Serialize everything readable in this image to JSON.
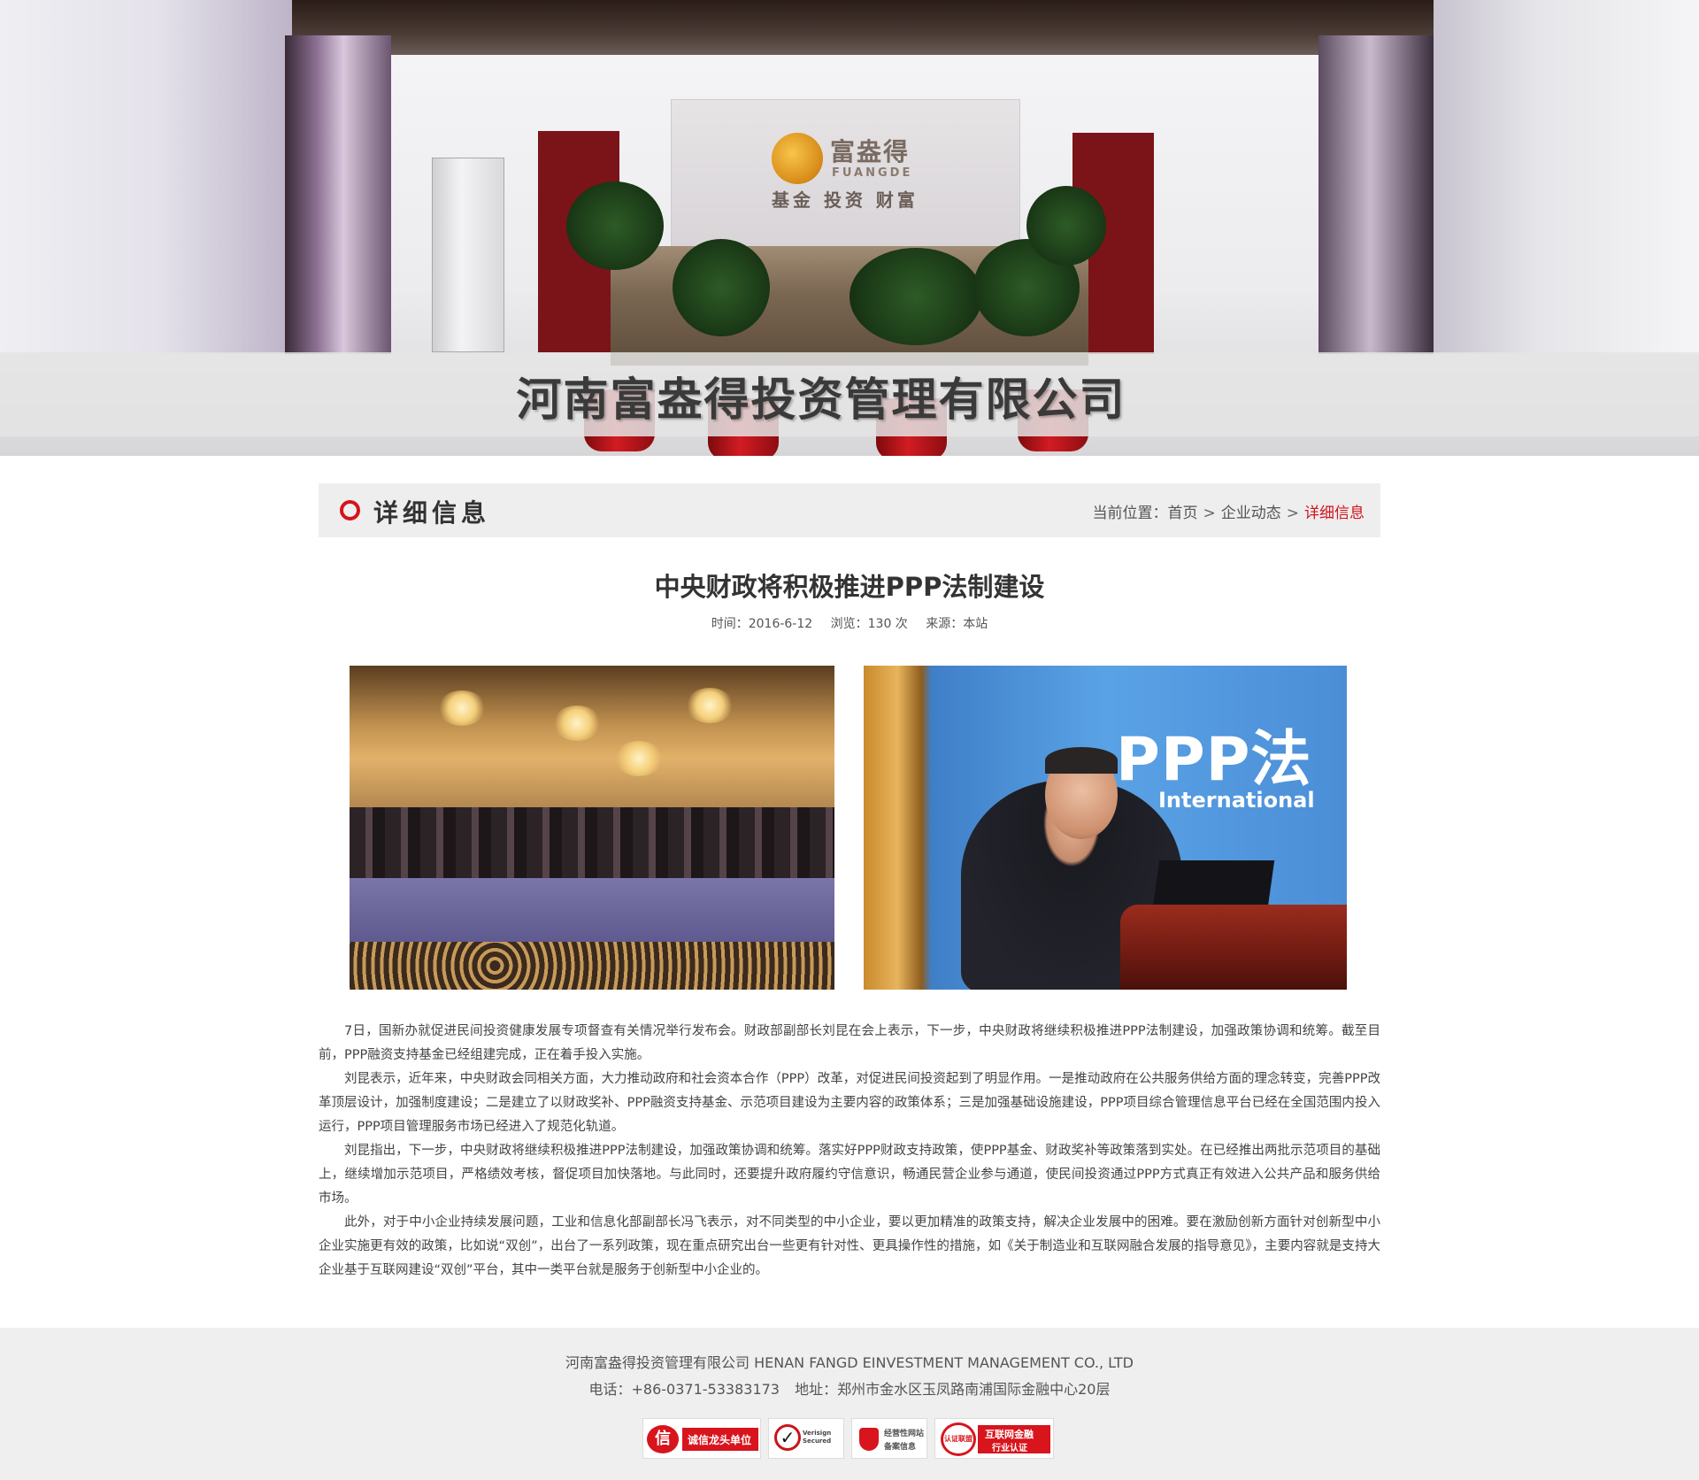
{
  "hero": {
    "title": "河南富盎得投资管理有限公司",
    "logo_cn": "富盎得",
    "logo_en": "FUANGDE",
    "logo_tagline": "基金 投资 财富"
  },
  "section": {
    "title": "详细信息",
    "breadcrumb": {
      "prefix": "当前位置：",
      "items": [
        "首页",
        "企业动态"
      ],
      "separator": ">",
      "current": "详细信息"
    }
  },
  "article": {
    "title": "中央财政将积极推进PPP法制建设",
    "meta": {
      "time": "时间：2016-6-12",
      "views": "浏览：130 次",
      "source": "来源：本站"
    },
    "photo_2_text": {
      "ppp": "PPP法",
      "international": "International"
    },
    "paragraphs": [
      "7日，国新办就促进民间投资健康发展专项督查有关情况举行发布会。财政部副部长刘昆在会上表示，下一步，中央财政将继续积极推进PPP法制建设，加强政策协调和统筹。截至目前，PPP融资支持基金已经组建完成，正在着手投入实施。",
      "刘昆表示，近年来，中央财政会同相关方面，大力推动政府和社会资本合作（PPP）改革，对促进民间投资起到了明显作用。一是推动政府在公共服务供给方面的理念转变，完善PPP改革顶层设计，加强制度建设；二是建立了以财政奖补、PPP融资支持基金、示范项目建设为主要内容的政策体系；三是加强基础设施建设，PPP项目综合管理信息平台已经在全国范围内投入运行，PPP项目管理服务市场已经进入了规范化轨道。",
      "刘昆指出，下一步，中央财政将继续积极推进PPP法制建设，加强政策协调和统筹。落实好PPP财政支持政策，使PPP基金、财政奖补等政策落到实处。在已经推出两批示范项目的基础上，继续增加示范项目，严格绩效考核，督促项目加快落地。与此同时，还要提升政府履约守信意识，畅通民营企业参与通道，使民间投资通过PPP方式真正有效进入公共产品和服务供给市场。",
      "此外，对于中小企业持续发展问题，工业和信息化部副部长冯飞表示，对不同类型的中小企业，要以更加精准的政策支持，解决企业发展中的困难。要在激励创新方面针对创新型中小企业实施更有效的政策，比如说“双创”，出台了一系列政策，现在重点研究出台一些更有针对性、更具操作性的措施，如《关于制造业和互联网融合发展的指导意见》，主要内容就是支持大企业基于互联网建设“双创”平台，其中一类平台就是服务于创新型中小企业的。"
    ]
  },
  "footer": {
    "company": "河南富盎得投资管理有限公司 HENAN FANGD EINVESTMENT MANAGEMENT CO., LTD",
    "phone": "电话：+86-0371-53383173",
    "address": "地址：郑州市金水区玉凤路南浦国际金融中心20层",
    "badges": [
      {
        "icon_text": "信",
        "label": "诚信龙头单位"
      },
      {
        "label": "Verisign Secured"
      },
      {
        "label_line1": "经营性网站",
        "label_line2": "备案信息"
      },
      {
        "seal_text": "认证联盟",
        "label_line1": "互联网金融",
        "label_line2": "行业认证"
      }
    ]
  },
  "colors": {
    "accent": "#d0141b",
    "section_bg": "#eeeeee",
    "footer_bg": "#efefef"
  }
}
